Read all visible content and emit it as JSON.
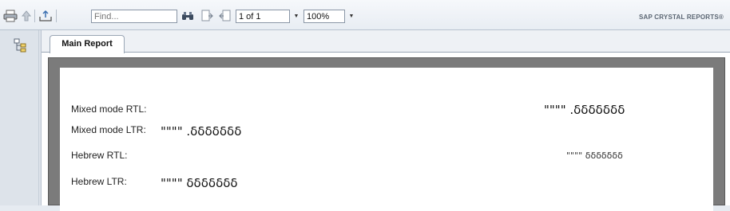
{
  "toolbar": {
    "search_placeholder": "Find...",
    "page_indicator": "1 of 1",
    "zoom_level": "100%",
    "brand": "SAP CRYSTAL REPORTS®"
  },
  "tabs": [
    {
      "label": "Main Report"
    }
  ],
  "report": {
    "rows": [
      {
        "label": "Mixed mode RTL:",
        "value": "\"\"\"\" .ẟẟẟẟẟẟẟ"
      },
      {
        "label": "Mixed mode LTR:",
        "value": "\"\"\"\" .ẟẟẟẟẟẟẟ"
      },
      {
        "label": "Hebrew RTL:",
        "value": "\"\"\"\"  ẟẟẟẟẟẟẟ"
      },
      {
        "label": "Hebrew LTR:",
        "value": "\"\"\"\"  ẟẟẟẟẟẟẟ"
      }
    ]
  },
  "colors": {
    "toolbar_bg": "#eef2f6",
    "canvas_bg": "#7b7b7b",
    "page_bg": "#ffffff"
  }
}
